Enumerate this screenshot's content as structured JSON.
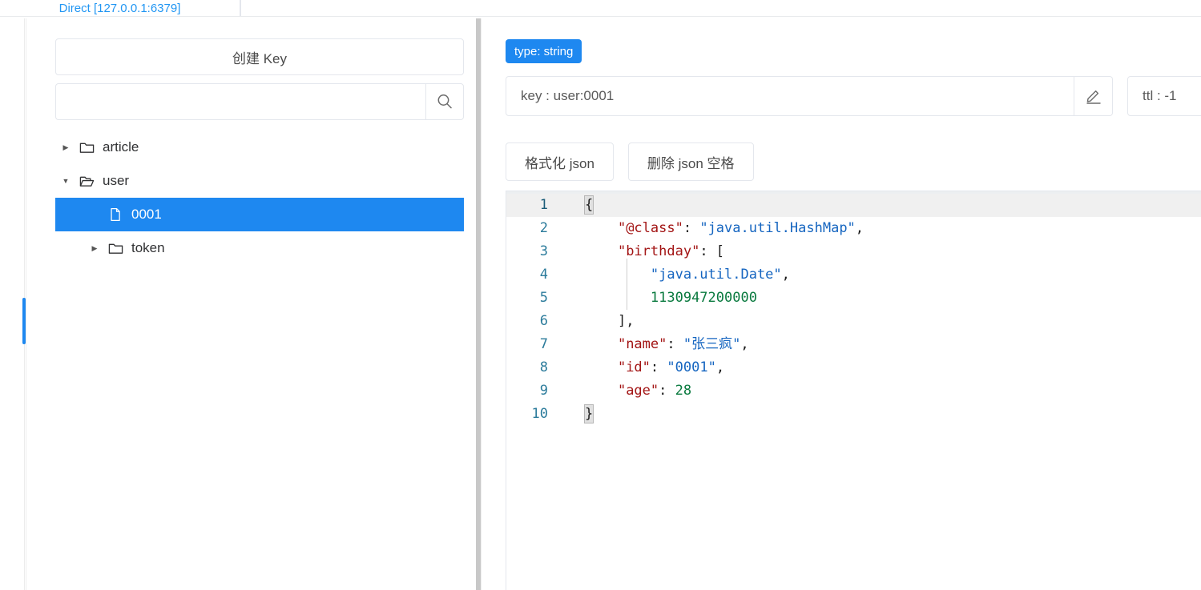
{
  "window": {
    "tabs": [
      {
        "label": "Direct [127.0.0.1:6379]",
        "active": true
      },
      {
        "label": "",
        "active": false
      }
    ]
  },
  "sidebar": {
    "create_key_label": "创建 Key",
    "search": {
      "value": "",
      "placeholder": "",
      "icon": "search-icon"
    },
    "tree": [
      {
        "label": "article",
        "type": "folder",
        "expanded": false,
        "depth": 0,
        "arrow": "▶",
        "selected": false
      },
      {
        "label": "user",
        "type": "folder-open",
        "expanded": true,
        "depth": 0,
        "arrow": "▼",
        "selected": false
      },
      {
        "label": "0001",
        "type": "file",
        "expanded": false,
        "depth": 1,
        "arrow": "",
        "selected": true
      },
      {
        "label": "token",
        "type": "folder",
        "expanded": false,
        "depth": 1,
        "arrow": "▶",
        "selected": false
      }
    ]
  },
  "main": {
    "type_badge": "type: string",
    "key_value": "key : user:0001",
    "key_edit_icon": "pencil-icon",
    "ttl_value": "ttl : -1",
    "buttons": [
      {
        "label": "格式化 json"
      },
      {
        "label": "删除 json 空格"
      }
    ],
    "editor": {
      "lines": [
        {
          "num": "1",
          "html": "<span class=\"tok-punc brk\">{</span>"
        },
        {
          "num": "2",
          "html": "    <span class=\"tok-key\">\"@class\"</span><span class=\"tok-punc\">: </span><span class=\"tok-str\">\"java.util.HashMap\"</span><span class=\"tok-punc\">,</span>"
        },
        {
          "num": "3",
          "html": "    <span class=\"tok-key\">\"birthday\"</span><span class=\"tok-punc\">: [</span>"
        },
        {
          "num": "4",
          "html": "        <span class=\"tok-str\">\"java.util.Date\"</span><span class=\"tok-punc\">,</span>"
        },
        {
          "num": "5",
          "html": "        <span class=\"tok-num\">1130947200000</span>"
        },
        {
          "num": "6",
          "html": "    <span class=\"tok-punc\">],</span>"
        },
        {
          "num": "7",
          "html": "    <span class=\"tok-key\">\"name\"</span><span class=\"tok-punc\">: </span><span class=\"tok-str\">\"张三疯\"</span><span class=\"tok-punc\">,</span>"
        },
        {
          "num": "8",
          "html": "    <span class=\"tok-key\">\"id\"</span><span class=\"tok-punc\">: </span><span class=\"tok-str\">\"0001\"</span><span class=\"tok-punc\">,</span>"
        },
        {
          "num": "9",
          "html": "    <span class=\"tok-key\">\"age\"</span><span class=\"tok-punc\">: </span><span class=\"tok-num\">28</span>"
        },
        {
          "num": "10",
          "html": "<span class=\"tok-punc brk\">}</span>"
        }
      ],
      "raw_json": "{\n    \"@class\": \"java.util.HashMap\",\n    \"birthday\": [\n        \"java.util.Date\",\n        1130947200000\n    ],\n    \"name\": \"张三疯\",\n    \"id\": \"0001\",\n    \"age\": 28\n}"
    }
  },
  "colors": {
    "accent": "#1e88f0",
    "border": "#e4e7ed",
    "splitter": "#c8c8c8",
    "json_key": "#a31515",
    "json_string": "#1565c0",
    "json_number": "#0a7a3f",
    "gutter_text": "#2b7b9b",
    "active_line": "#f0f0f0"
  }
}
